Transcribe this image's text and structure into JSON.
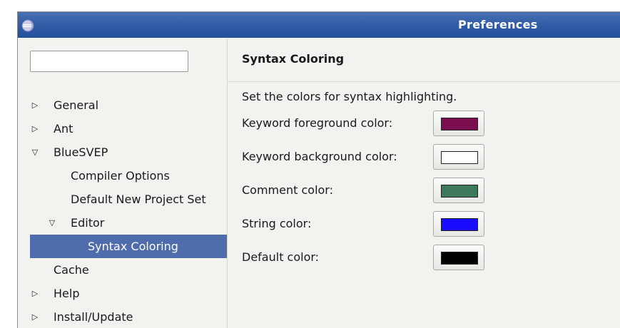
{
  "window": {
    "title": "Preferences",
    "app_icon": "eclipse-icon"
  },
  "sidebar": {
    "filter": {
      "value": "",
      "placeholder": ""
    },
    "items": [
      {
        "label": "General",
        "expander": "collapsed"
      },
      {
        "label": "Ant",
        "expander": "collapsed"
      },
      {
        "label": "BlueSVEP",
        "expander": "expanded"
      },
      {
        "label": "Compiler Options",
        "expander": "none"
      },
      {
        "label": "Default New Project Set",
        "expander": "none"
      },
      {
        "label": "Editor",
        "expander": "expanded"
      },
      {
        "label": "Syntax Coloring",
        "expander": "none",
        "selected": true
      },
      {
        "label": "Cache",
        "expander": "none"
      },
      {
        "label": "Help",
        "expander": "collapsed"
      },
      {
        "label": "Install/Update",
        "expander": "collapsed"
      }
    ]
  },
  "main": {
    "title": "Syntax Coloring",
    "description": "Set the colors for syntax highlighting.",
    "colors": [
      {
        "label": "Keyword foreground color:",
        "value": "#7a0e4f"
      },
      {
        "label": "Keyword background color:",
        "value": "#ffffff"
      },
      {
        "label": "Comment color:",
        "value": "#3d7a5c"
      },
      {
        "label": "String color:",
        "value": "#1a0dff"
      },
      {
        "label": "Default color:",
        "value": "#000000"
      }
    ]
  },
  "theme": {
    "titlebar": "#2f5aa4",
    "selection": "#4f6dad"
  }
}
